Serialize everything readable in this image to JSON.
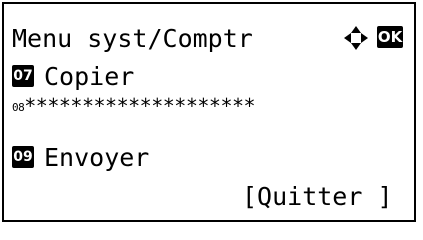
{
  "screen": {
    "title": "Menu syst/Comptr",
    "ok_key": "OK",
    "items": [
      {
        "number": "07",
        "label": "Copier"
      },
      {
        "number": "08",
        "label": "********************"
      },
      {
        "number": "09",
        "label": "Envoyer"
      }
    ],
    "softkey": "[Quitter ]"
  },
  "icons": {
    "nav": "four-way-arrow-icon"
  }
}
